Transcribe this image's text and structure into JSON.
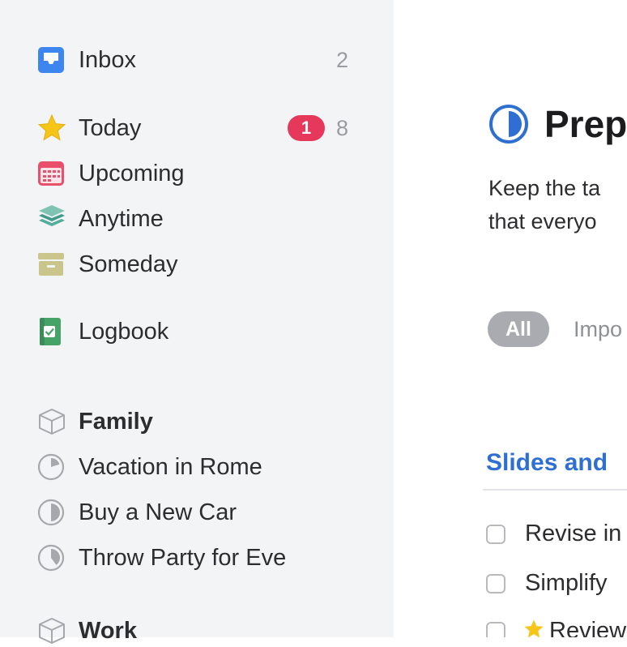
{
  "sidebar": {
    "inbox": {
      "label": "Inbox",
      "count": "2",
      "icon": "inbox-icon"
    },
    "today": {
      "label": "Today",
      "badge": "1",
      "count": "8",
      "icon": "star-icon"
    },
    "upcoming": {
      "label": "Upcoming",
      "icon": "calendar-icon"
    },
    "anytime": {
      "label": "Anytime",
      "icon": "layers-icon"
    },
    "someday": {
      "label": "Someday",
      "icon": "archive-box-icon"
    },
    "logbook": {
      "label": "Logbook",
      "icon": "logbook-icon"
    },
    "areas": [
      {
        "label": "Family",
        "icon": "area-cube-icon",
        "projects": [
          {
            "label": "Vacation in Rome",
            "progress": 0.2
          },
          {
            "label": "Buy a New Car",
            "progress": 0.5
          },
          {
            "label": "Throw Party for Eve",
            "progress": 0.4
          }
        ]
      },
      {
        "label": "Work",
        "icon": "area-cube-icon"
      }
    ]
  },
  "main": {
    "project_title": "Prep",
    "project_progress": 0.5,
    "notes_line1": "Keep the ta",
    "notes_line2": "that everyo",
    "filters": {
      "all": "All",
      "tag1": "Impo"
    },
    "heading": "Slides and",
    "todos": [
      {
        "label": "Revise in",
        "starred": false
      },
      {
        "label": "Simplify",
        "starred": false
      },
      {
        "label": "Review",
        "starred": true
      }
    ]
  },
  "colors": {
    "sidebar_bg": "#f3f4f6",
    "accent_blue": "#2f6fd1",
    "badge_red": "#e5385a",
    "today_star": "#f5c518",
    "upcoming_red": "#e8506b",
    "anytime_teal": "#3f9a8a",
    "someday_khaki": "#c9c58b",
    "logbook_green": "#46a368"
  }
}
